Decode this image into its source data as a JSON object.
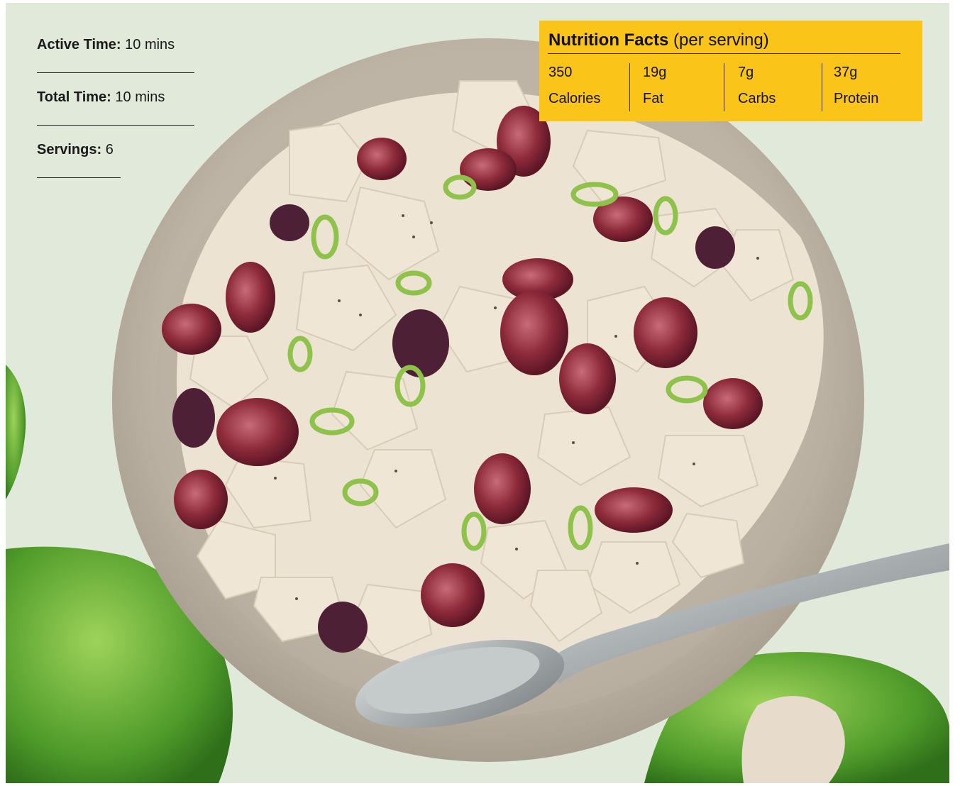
{
  "recipe": {
    "active_time": {
      "label": "Active Time:",
      "value": "10 mins"
    },
    "total_time": {
      "label": "Total Time:",
      "value": "10 mins"
    },
    "servings": {
      "label": "Servings:",
      "value": "6"
    }
  },
  "nutrition": {
    "title": "Nutrition Facts",
    "subtitle": "(per serving)",
    "items": [
      {
        "value": "350",
        "label": "Calories"
      },
      {
        "value": "19g",
        "label": "Fat"
      },
      {
        "value": "7g",
        "label": "Carbs"
      },
      {
        "value": "37g",
        "label": "Protein"
      }
    ]
  },
  "colors": {
    "accent": "#fbc419",
    "text": "#1a1a1a",
    "background": "#e5ecdf"
  }
}
